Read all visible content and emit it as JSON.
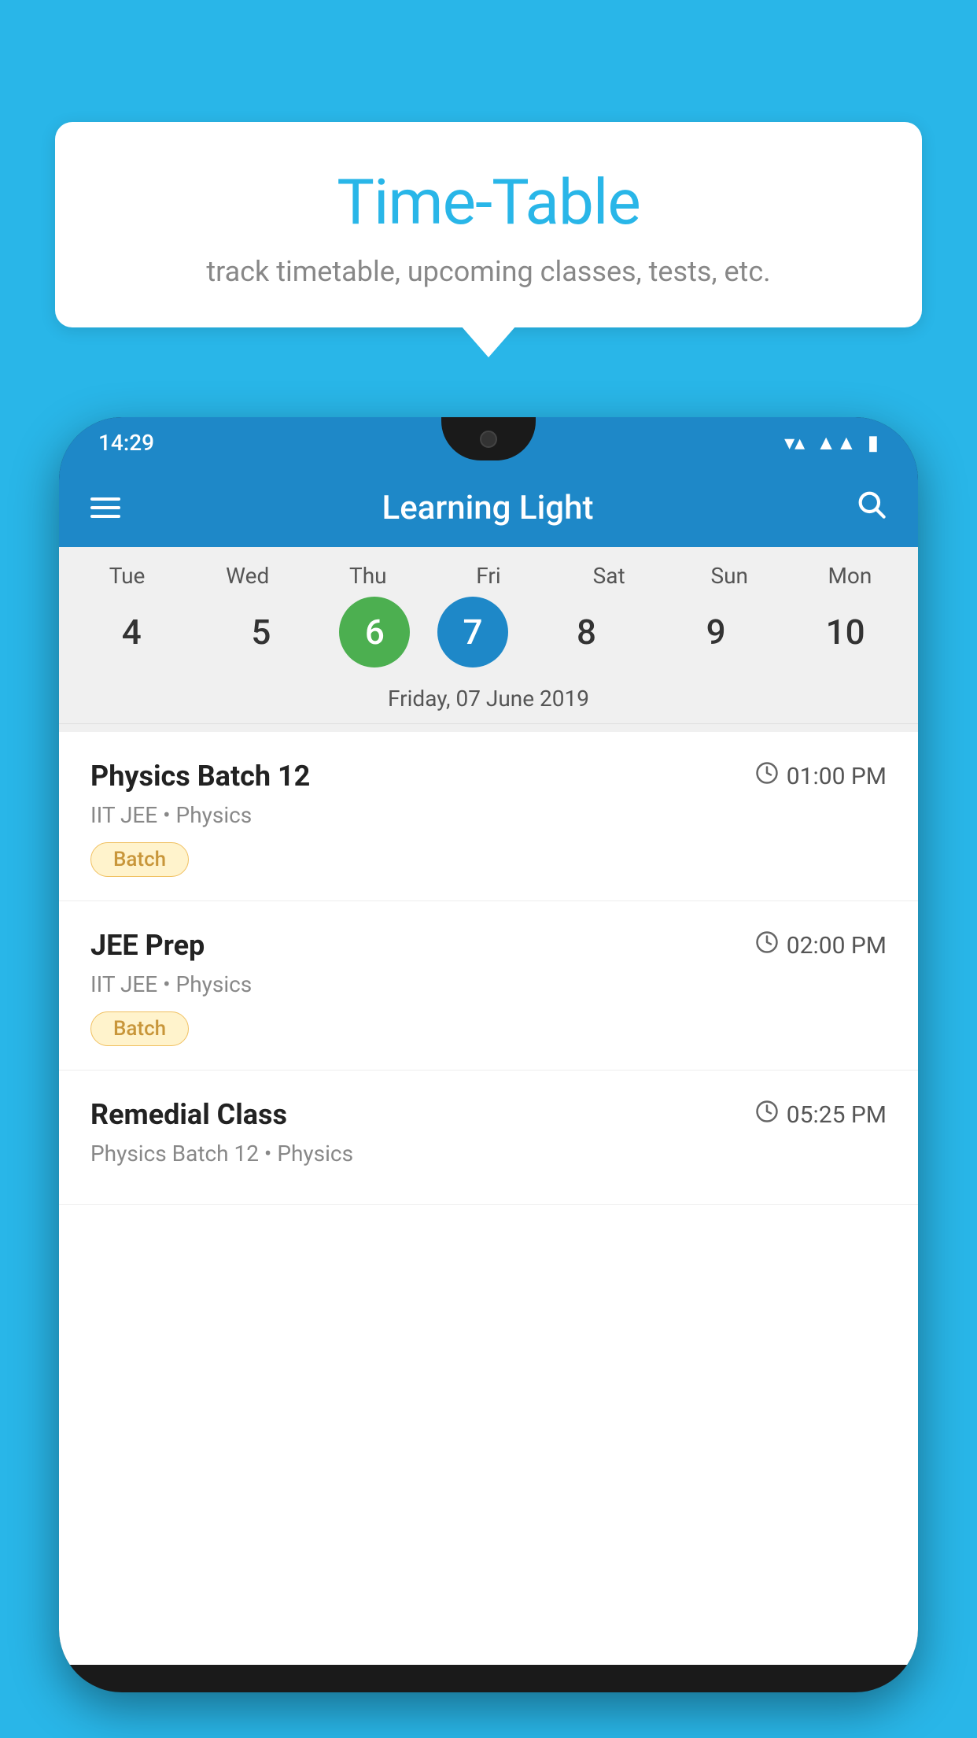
{
  "background_color": "#29b6e8",
  "tooltip": {
    "title": "Time-Table",
    "subtitle": "track timetable, upcoming classes, tests, etc."
  },
  "phone": {
    "status_bar": {
      "time": "14:29"
    },
    "app_header": {
      "title": "Learning Light"
    },
    "calendar": {
      "days": [
        {
          "label": "Tue",
          "num": "4"
        },
        {
          "label": "Wed",
          "num": "5"
        },
        {
          "label": "Thu",
          "num": "6",
          "state": "today"
        },
        {
          "label": "Fri",
          "num": "7",
          "state": "selected"
        },
        {
          "label": "Sat",
          "num": "8"
        },
        {
          "label": "Sun",
          "num": "9"
        },
        {
          "label": "Mon",
          "num": "10"
        }
      ],
      "selected_date_label": "Friday, 07 June 2019"
    },
    "schedule": [
      {
        "name": "Physics Batch 12",
        "time": "01:00 PM",
        "meta": "IIT JEE • Physics",
        "badge": "Batch"
      },
      {
        "name": "JEE Prep",
        "time": "02:00 PM",
        "meta": "IIT JEE • Physics",
        "badge": "Batch"
      },
      {
        "name": "Remedial Class",
        "time": "05:25 PM",
        "meta": "Physics Batch 12 • Physics",
        "badge": null
      }
    ]
  }
}
